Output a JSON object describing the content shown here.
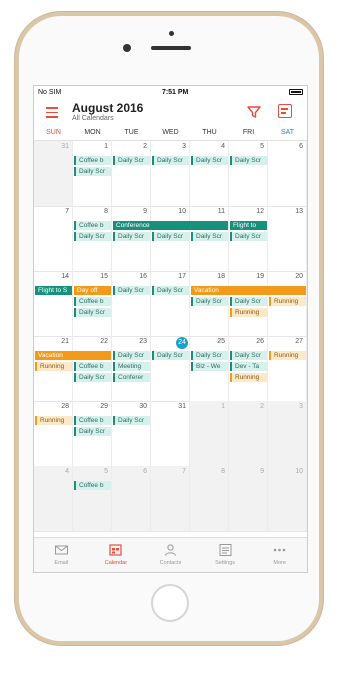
{
  "status_bar": {
    "carrier": "No SIM",
    "time": "7:51 PM"
  },
  "header": {
    "title": "August 2016",
    "subtitle": "All Calendars"
  },
  "weekdays": [
    "SUN",
    "MON",
    "TUE",
    "WED",
    "THU",
    "FRI",
    "SAT"
  ],
  "weeks": [
    {
      "days": [
        "31",
        "1",
        "2",
        "3",
        "4",
        "5",
        "6"
      ],
      "out": [
        0
      ]
    },
    {
      "days": [
        "7",
        "8",
        "9",
        "10",
        "11",
        "12",
        "13"
      ],
      "out": []
    },
    {
      "days": [
        "14",
        "15",
        "16",
        "17",
        "18",
        "19",
        "20"
      ],
      "out": []
    },
    {
      "days": [
        "21",
        "22",
        "23",
        "24",
        "25",
        "26",
        "27"
      ],
      "out": [],
      "today": 3
    },
    {
      "days": [
        "28",
        "29",
        "30",
        "31",
        "1",
        "2",
        "3"
      ],
      "out": [
        4,
        5,
        6
      ]
    },
    {
      "days": [
        "4",
        "5",
        "6",
        "7",
        "8",
        "9",
        "10"
      ],
      "out": [
        0,
        1,
        2,
        3,
        4,
        5,
        6
      ]
    }
  ],
  "events": [
    {
      "w": 0,
      "d": 1,
      "span": 1,
      "row": 0,
      "style": "s",
      "label": "Coffee b"
    },
    {
      "w": 0,
      "d": 1,
      "span": 1,
      "row": 1,
      "style": "s",
      "label": "Daily Scr"
    },
    {
      "w": 0,
      "d": 2,
      "span": 1,
      "row": 0,
      "style": "s",
      "label": "Daily Scr"
    },
    {
      "w": 0,
      "d": 3,
      "span": 1,
      "row": 0,
      "style": "s",
      "label": "Daily Scr"
    },
    {
      "w": 0,
      "d": 4,
      "span": 1,
      "row": 0,
      "style": "s",
      "label": "Daily Scr"
    },
    {
      "w": 0,
      "d": 5,
      "span": 1,
      "row": 0,
      "style": "s",
      "label": "Daily Scr"
    },
    {
      "w": 1,
      "d": 1,
      "span": 1,
      "row": 0,
      "style": "s",
      "label": "Coffee b"
    },
    {
      "w": 1,
      "d": 1,
      "span": 1,
      "row": 1,
      "style": "s",
      "label": "Daily Scr"
    },
    {
      "w": 1,
      "d": 2,
      "span": 3,
      "row": 0,
      "style": "b",
      "label": "Conference"
    },
    {
      "w": 1,
      "d": 2,
      "span": 1,
      "row": 1,
      "style": "s",
      "label": "Daily Scr"
    },
    {
      "w": 1,
      "d": 3,
      "span": 1,
      "row": 1,
      "style": "s",
      "label": "Daily Scr"
    },
    {
      "w": 1,
      "d": 4,
      "span": 1,
      "row": 1,
      "style": "s",
      "label": "Daily Scr"
    },
    {
      "w": 1,
      "d": 5,
      "span": 1,
      "row": 0,
      "style": "b",
      "label": "Flight to"
    },
    {
      "w": 1,
      "d": 5,
      "span": 1,
      "row": 1,
      "style": "s",
      "label": "Daily Scr"
    },
    {
      "w": 2,
      "d": 0,
      "span": 1,
      "row": 0,
      "style": "b",
      "label": "Flight to S"
    },
    {
      "w": 2,
      "d": 1,
      "span": 1,
      "row": 0,
      "style": "o",
      "label": "Day off"
    },
    {
      "w": 2,
      "d": 1,
      "span": 1,
      "row": 1,
      "style": "s",
      "label": "Coffee b"
    },
    {
      "w": 2,
      "d": 1,
      "span": 1,
      "row": 2,
      "style": "s",
      "label": "Daily Scr"
    },
    {
      "w": 2,
      "d": 2,
      "span": 1,
      "row": 0,
      "style": "s",
      "label": "Daily Scr"
    },
    {
      "w": 2,
      "d": 3,
      "span": 1,
      "row": 0,
      "style": "s",
      "label": "Daily Scr"
    },
    {
      "w": 2,
      "d": 4,
      "span": 3,
      "row": 0,
      "style": "o",
      "label": "Vacation"
    },
    {
      "w": 2,
      "d": 4,
      "span": 1,
      "row": 1,
      "style": "s",
      "label": "Daily Scr"
    },
    {
      "w": 2,
      "d": 5,
      "span": 1,
      "row": 1,
      "style": "s",
      "label": "Daily Scr"
    },
    {
      "w": 2,
      "d": 5,
      "span": 1,
      "row": 2,
      "style": "os",
      "label": "Running"
    },
    {
      "w": 2,
      "d": 6,
      "span": 1,
      "row": 1,
      "style": "os",
      "label": "Running"
    },
    {
      "w": 3,
      "d": 0,
      "span": 2,
      "row": 0,
      "style": "o",
      "label": "Vacation"
    },
    {
      "w": 3,
      "d": 0,
      "span": 1,
      "row": 1,
      "style": "os",
      "label": "Running"
    },
    {
      "w": 3,
      "d": 1,
      "span": 1,
      "row": 1,
      "style": "s",
      "label": "Coffee b"
    },
    {
      "w": 3,
      "d": 1,
      "span": 1,
      "row": 2,
      "style": "s",
      "label": "Daily Scr"
    },
    {
      "w": 3,
      "d": 2,
      "span": 1,
      "row": 0,
      "style": "s",
      "label": "Daily Scr"
    },
    {
      "w": 3,
      "d": 2,
      "span": 1,
      "row": 1,
      "style": "s",
      "label": "Meeting"
    },
    {
      "w": 3,
      "d": 2,
      "span": 1,
      "row": 2,
      "style": "s",
      "label": "Conferer"
    },
    {
      "w": 3,
      "d": 3,
      "span": 1,
      "row": 0,
      "style": "s",
      "label": "Daily Scr"
    },
    {
      "w": 3,
      "d": 4,
      "span": 1,
      "row": 0,
      "style": "s",
      "label": "Daily Scr"
    },
    {
      "w": 3,
      "d": 4,
      "span": 1,
      "row": 1,
      "style": "s",
      "label": "Biz - We"
    },
    {
      "w": 3,
      "d": 5,
      "span": 1,
      "row": 0,
      "style": "s",
      "label": "Daily Scr"
    },
    {
      "w": 3,
      "d": 5,
      "span": 1,
      "row": 1,
      "style": "s",
      "label": "Dev - Ta"
    },
    {
      "w": 3,
      "d": 5,
      "span": 1,
      "row": 2,
      "style": "os",
      "label": "Running"
    },
    {
      "w": 3,
      "d": 6,
      "span": 1,
      "row": 0,
      "style": "os",
      "label": "Running"
    },
    {
      "w": 4,
      "d": 0,
      "span": 1,
      "row": 0,
      "style": "os",
      "label": "Running"
    },
    {
      "w": 4,
      "d": 1,
      "span": 1,
      "row": 0,
      "style": "s",
      "label": "Coffee b"
    },
    {
      "w": 4,
      "d": 1,
      "span": 1,
      "row": 1,
      "style": "s",
      "label": "Daily Scr"
    },
    {
      "w": 4,
      "d": 2,
      "span": 1,
      "row": 0,
      "style": "s",
      "label": "Daily Scr"
    },
    {
      "w": 5,
      "d": 1,
      "span": 1,
      "row": 0,
      "style": "s",
      "label": "Coffee b"
    }
  ],
  "tabs": [
    {
      "label": "Email",
      "icon": "envelope-icon",
      "active": false
    },
    {
      "label": "Calendar",
      "icon": "calendar-icon",
      "active": true
    },
    {
      "label": "Contacts",
      "icon": "person-icon",
      "active": false
    },
    {
      "label": "Settings",
      "icon": "settings-icon",
      "active": false
    },
    {
      "label": "More",
      "icon": "more-icon",
      "active": false
    }
  ],
  "colors": {
    "accent": "#e74c3c",
    "teal": "#17917c",
    "orange": "#f49a1a",
    "today": "#1ba1c9"
  }
}
